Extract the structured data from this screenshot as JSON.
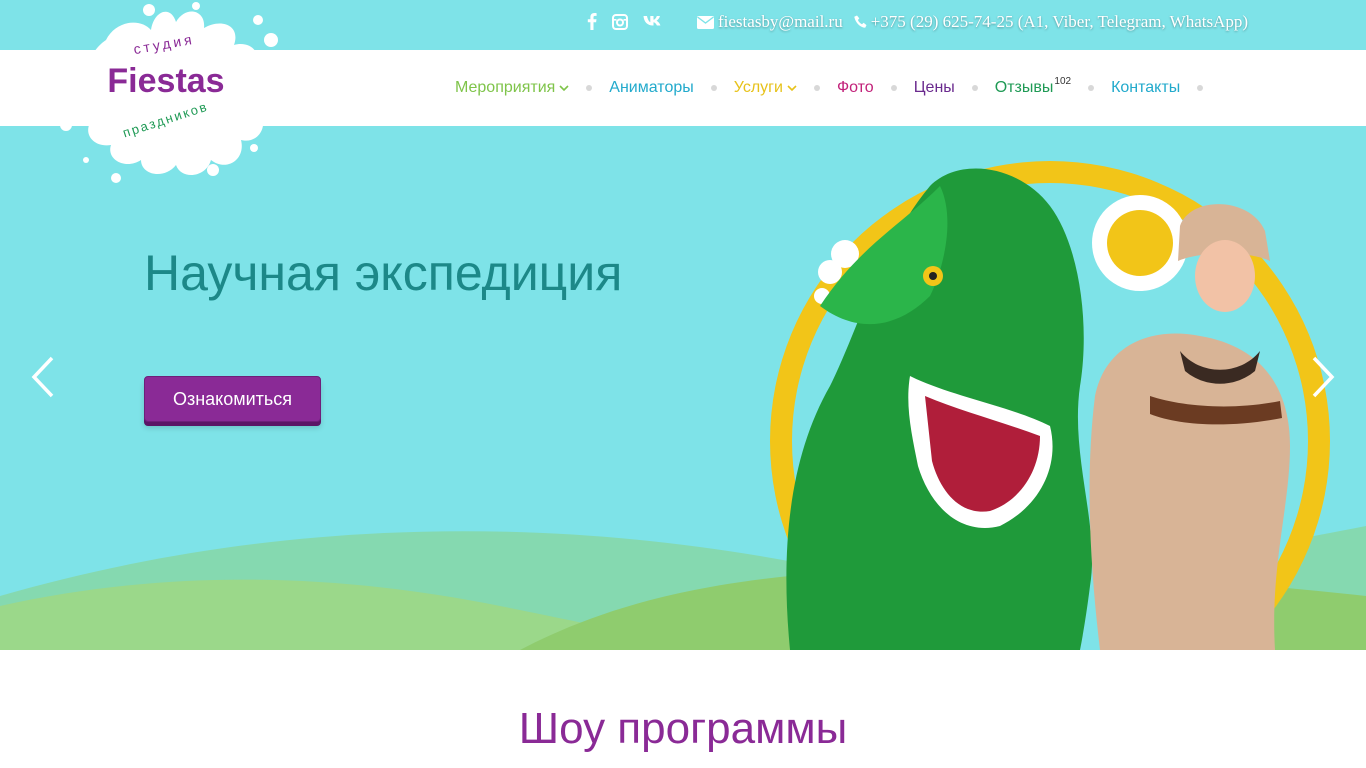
{
  "topbar": {
    "social": [
      {
        "name": "facebook-icon",
        "glyph": "f"
      },
      {
        "name": "instagram-icon",
        "glyph": ""
      },
      {
        "name": "vk-icon",
        "glyph": "vk"
      }
    ],
    "email": "fiestasby@mail.ru",
    "phone": "+375 (29) 625-74-25 (A1, Viber, Telegram, WhatsApp)"
  },
  "logo": {
    "top_text": "студия",
    "brand": "Fiestas",
    "bottom_text": "праздников"
  },
  "nav": {
    "items": [
      {
        "label": "Мероприятия",
        "color": "#7fc44a",
        "dropdown": true
      },
      {
        "label": "Аниматоры",
        "color": "#22aacc"
      },
      {
        "label": "Услуги",
        "color": "#e7c21a",
        "dropdown": true
      },
      {
        "label": "Фото",
        "color": "#c2227a"
      },
      {
        "label": "Цены",
        "color": "#6a2a8e"
      },
      {
        "label": "Отзывы",
        "color": "#1f9a55",
        "badge": "102"
      },
      {
        "label": "Контакты",
        "color": "#22aacc"
      }
    ]
  },
  "hero": {
    "title": "Научная экспедиция",
    "button_label": "Ознакомиться",
    "colors": {
      "background": "#7ee3e8",
      "title": "#1c8888",
      "button": "#8a2a96"
    }
  },
  "section": {
    "title": "Шоу программы"
  }
}
